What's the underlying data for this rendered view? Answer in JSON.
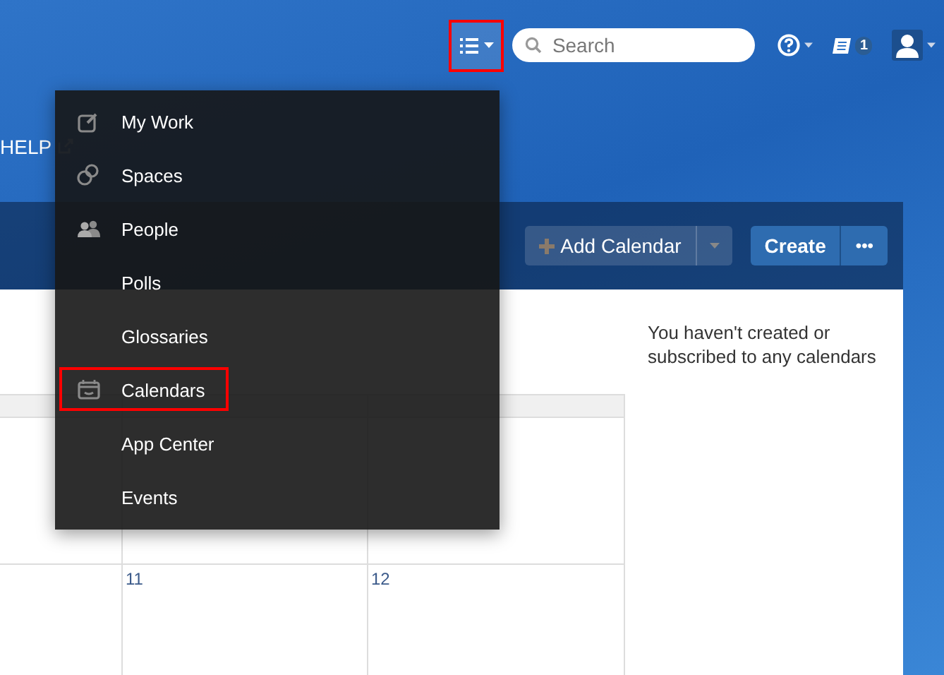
{
  "header": {
    "menu_button": {
      "highlighted": true
    },
    "search": {
      "placeholder": "Search"
    },
    "notification_count": "1"
  },
  "nav": {
    "help_link": "HELP"
  },
  "toolbar": {
    "add_calendar": "Add Calendar",
    "create": "Create",
    "more": "•••"
  },
  "calendar": {
    "visible_week": {
      "days": [
        "11",
        "12"
      ]
    }
  },
  "side_panel": {
    "message": "You haven't created or subscribed to any calendars"
  },
  "menu": {
    "items": [
      {
        "label": "My Work",
        "highlighted": false
      },
      {
        "label": "Spaces",
        "highlighted": false
      },
      {
        "label": "People",
        "highlighted": false
      },
      {
        "label": "Polls",
        "highlighted": false
      },
      {
        "label": "Glossaries",
        "highlighted": false
      },
      {
        "label": "Calendars",
        "highlighted": true
      },
      {
        "label": "App Center",
        "highlighted": false
      },
      {
        "label": "Events",
        "highlighted": false
      }
    ]
  }
}
